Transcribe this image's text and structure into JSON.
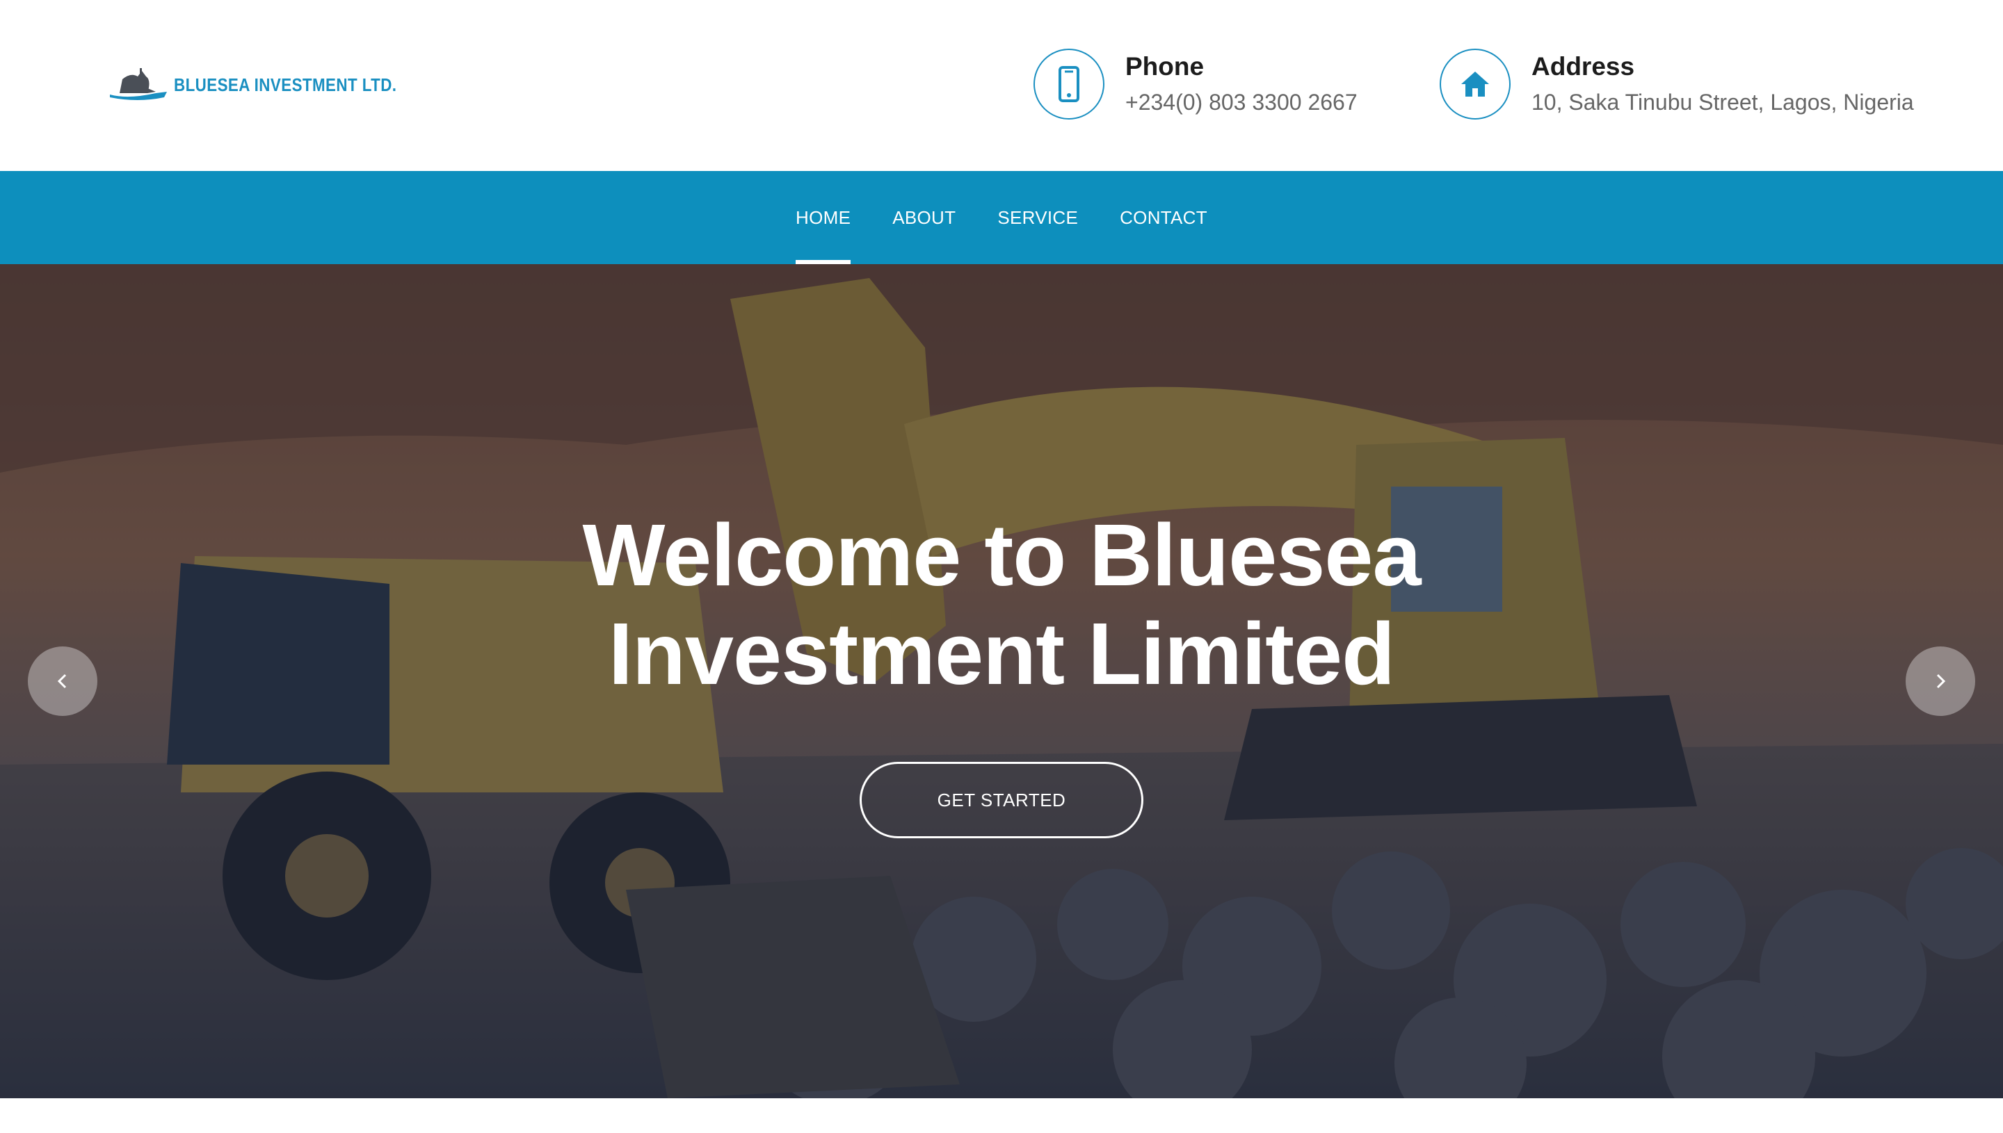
{
  "brand": {
    "name": "BLUESEA INVESTMENT LTD.",
    "logo_icon": "ship-logo-icon",
    "accent_color": "#0d8fbd"
  },
  "contact": {
    "phone": {
      "icon": "mobile-phone-icon",
      "title": "Phone",
      "value": "+234(0) 803 3300 2667"
    },
    "address": {
      "icon": "home-icon",
      "title": "Address",
      "value": "10, Saka Tinubu Street, Lagos, Nigeria"
    }
  },
  "nav": {
    "items": [
      {
        "label": "HOME",
        "active": true
      },
      {
        "label": "ABOUT",
        "active": false
      },
      {
        "label": "SERVICE",
        "active": false
      },
      {
        "label": "CONTACT",
        "active": false
      }
    ]
  },
  "hero": {
    "title_line1": "Welcome to Bluesea",
    "title_line2": "Investment Limited",
    "cta_label": "GET STARTED",
    "prev_icon": "chevron-left-icon",
    "next_icon": "chevron-right-icon"
  }
}
